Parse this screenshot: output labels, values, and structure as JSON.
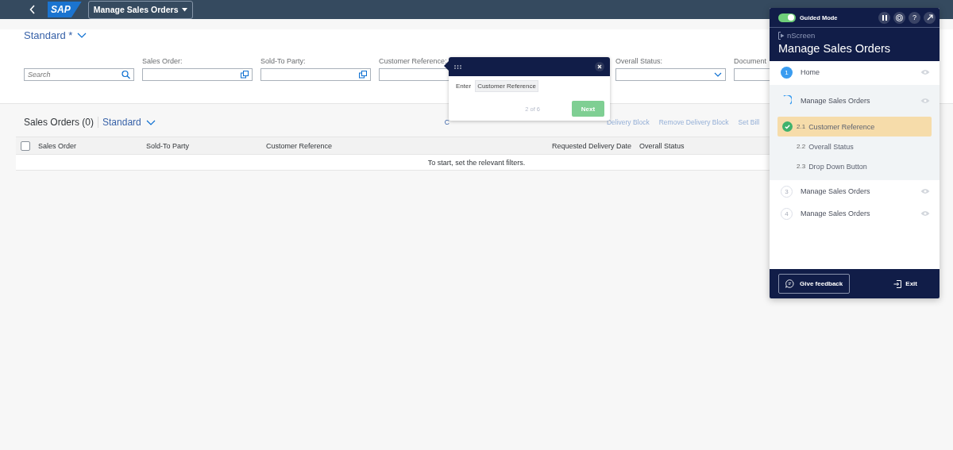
{
  "shell": {
    "logo": "SAP",
    "app_title": "Manage Sales Orders"
  },
  "variant": {
    "label": "Standard *"
  },
  "filters": [
    {
      "placeholder": "Search",
      "kind": "search"
    },
    {
      "label": "Sales Order:",
      "kind": "valuehelp"
    },
    {
      "label": "Sold-To Party:",
      "kind": "valuehelp"
    },
    {
      "label": "Customer Reference:",
      "kind": "text"
    },
    {
      "label": "Overall Status:",
      "kind": "dropdown"
    },
    {
      "label": "Document",
      "kind": "text"
    }
  ],
  "table": {
    "title": "Sales Orders (0)",
    "variant": "Standard",
    "actions": [
      {
        "label": "C",
        "disabled": false
      },
      {
        "label": "Delivery Block",
        "disabled": true
      },
      {
        "label": "Remove Delivery Block",
        "disabled": true
      },
      {
        "label": "Set Bill",
        "disabled": true
      }
    ],
    "columns": [
      {
        "label": "Sales Order"
      },
      {
        "label": "Sold-To Party"
      },
      {
        "label": "Customer Reference"
      },
      {
        "label": "Requested Delivery Date"
      },
      {
        "label": "Overall Status"
      }
    ],
    "select_all": {
      "checked": false
    },
    "empty_text": "To start, set the relevant filters."
  },
  "popover": {
    "verb": "Enter",
    "target": "Customer Reference",
    "progress": "2 of 6",
    "next": "Next"
  },
  "guide": {
    "guided_mode": {
      "label": "Guided Mode",
      "on": true
    },
    "help": "?",
    "brand": "nScreen",
    "title": "Manage Sales Orders",
    "steps": [
      {
        "number": "1",
        "label": "Home",
        "kind": "current"
      },
      {
        "label": "Manage Sales Orders",
        "kind": "running",
        "expanded": true,
        "children": [
          {
            "number": "2.1",
            "label": "Customer Reference",
            "done": true,
            "selected": true
          },
          {
            "number": "2.2",
            "label": "Overall Status",
            "done": false,
            "selected": false
          },
          {
            "number": "2.3",
            "label": "Drop Down Button",
            "done": false,
            "selected": false
          }
        ]
      },
      {
        "number": "3",
        "label": "Manage Sales Orders",
        "kind": "pending"
      },
      {
        "number": "4",
        "label": "Manage Sales Orders",
        "kind": "pending"
      }
    ],
    "feedback": "Give feedback",
    "exit": "Exit"
  }
}
